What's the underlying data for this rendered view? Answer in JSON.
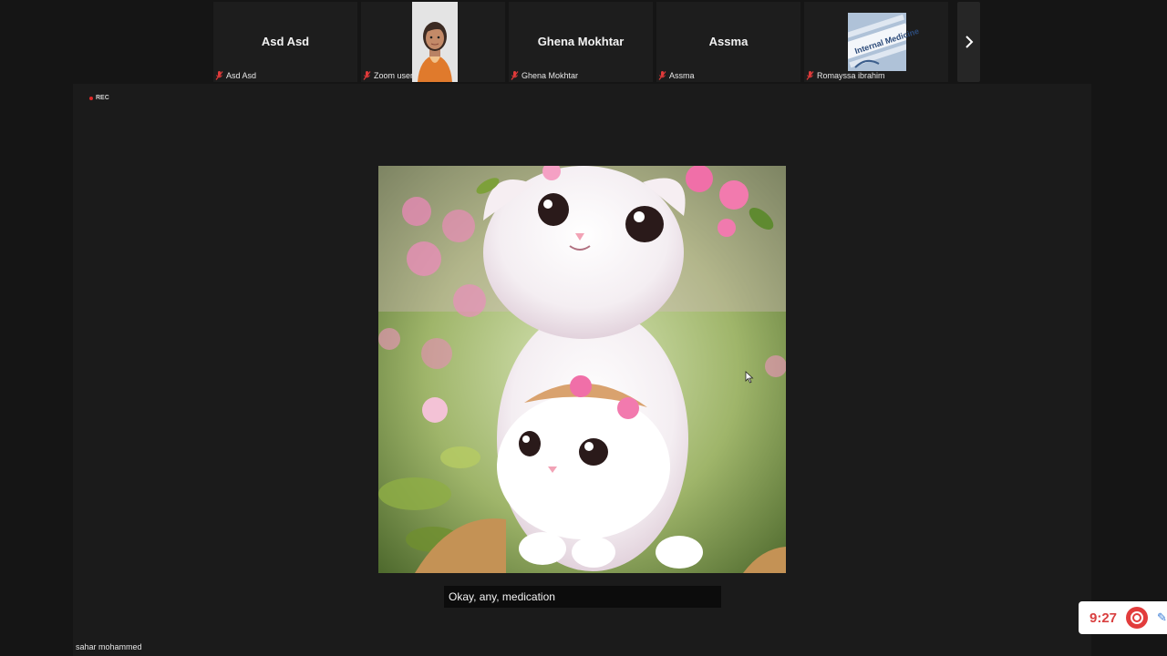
{
  "participants": [
    {
      "display_name": "Asd Asd",
      "caption": "Asd Asd",
      "muted": true
    },
    {
      "display_name": "",
      "caption": "Zoom user",
      "muted": true,
      "avatar": "photo-woman-avatar"
    },
    {
      "display_name": "Ghena Mokhtar",
      "caption": "Ghena Mokhtar",
      "muted": true
    },
    {
      "display_name": "Assma",
      "caption": "Assma",
      "muted": true
    },
    {
      "display_name": "",
      "caption": "Romayssa ibrahim",
      "muted": true,
      "avatar": "internal-medicine-image",
      "avatar_text": "Internal Medicine"
    }
  ],
  "strip_next_icon": "chevron-right-icon",
  "stage": {
    "recording_label": "REC",
    "subtitle": "Okay, any, medication",
    "active_speaker": "sahar mohammed"
  },
  "timer": {
    "time": "9:27",
    "stop_icon": "record-stop-icon"
  },
  "colors": {
    "muted_mic": "#e03a3a",
    "recording": "#e02828",
    "timer_text": "#d94040"
  }
}
